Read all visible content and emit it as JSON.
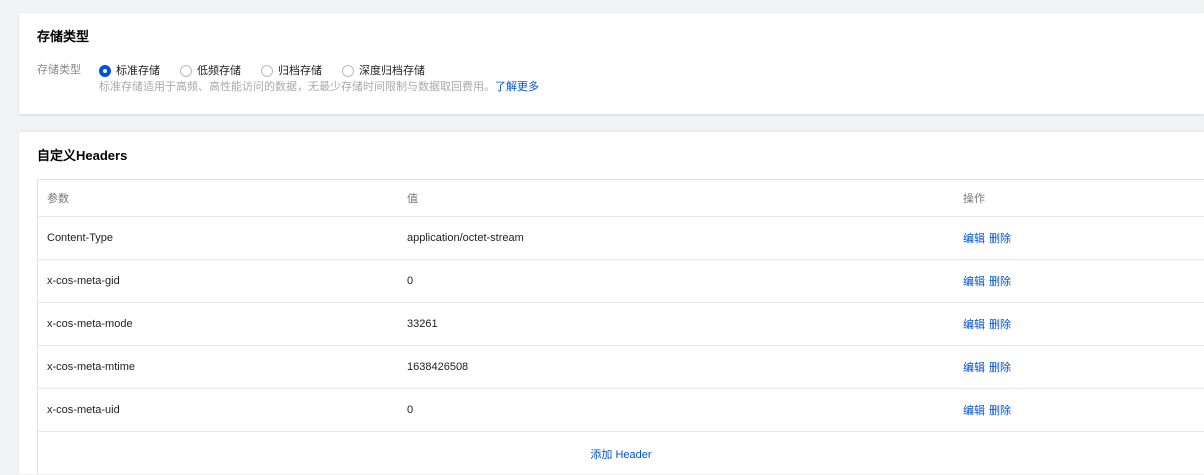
{
  "storage": {
    "title": "存储类型",
    "field_label": "存储类型",
    "options": [
      {
        "label": "标准存储",
        "checked": true
      },
      {
        "label": "低频存储",
        "checked": false
      },
      {
        "label": "归档存储",
        "checked": false
      },
      {
        "label": "深度归档存储",
        "checked": false
      }
    ],
    "hint": "标准存储适用于高频、高性能访问的数据，无最少存储时间限制与数据取回费用。",
    "learn_more": "了解更多"
  },
  "headers": {
    "title": "自定义Headers",
    "columns": {
      "param": "参数",
      "value": "值",
      "action": "操作"
    },
    "rows": [
      {
        "param": "Content-Type",
        "value": "application/octet-stream"
      },
      {
        "param": "x-cos-meta-gid",
        "value": "0"
      },
      {
        "param": "x-cos-meta-mode",
        "value": "33261"
      },
      {
        "param": "x-cos-meta-mtime",
        "value": "1638426508"
      },
      {
        "param": "x-cos-meta-uid",
        "value": "0"
      }
    ],
    "edit_label": "编辑",
    "delete_label": "删除",
    "add_label": "添加 Header"
  },
  "colors": {
    "accent": "#0052d9",
    "background": "#f2f3f5"
  }
}
